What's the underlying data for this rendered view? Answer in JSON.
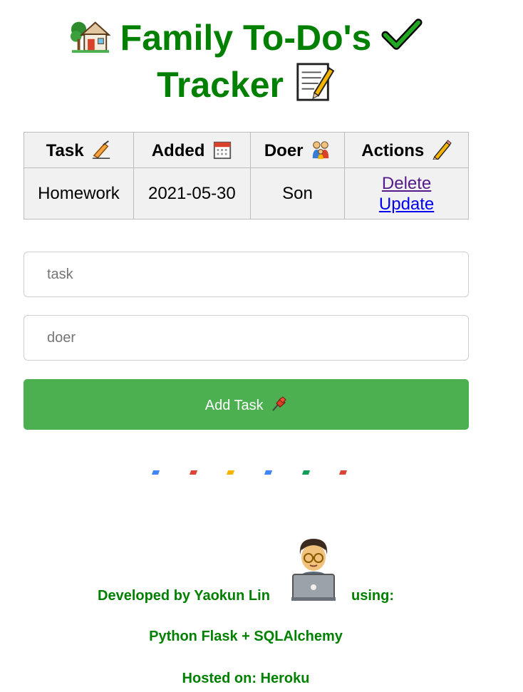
{
  "header": {
    "title_line1": "Family To-Do's",
    "title_line2": "Tracker",
    "icons": [
      "house-with-garden-icon",
      "check-mark-icon",
      "memo-icon"
    ]
  },
  "table": {
    "columns": [
      {
        "label": "Task",
        "icon": "writing-hand-icon"
      },
      {
        "label": "Added",
        "icon": "calendar-icon"
      },
      {
        "label": "Doer",
        "icon": "family-icon"
      },
      {
        "label": "Actions",
        "icon": "pencil-icon"
      }
    ],
    "rows": [
      {
        "task": "Homework",
        "added": "2021-05-30",
        "doer": "Son",
        "delete_label": "Delete",
        "update_label": "Update"
      }
    ]
  },
  "form": {
    "task_placeholder": "task",
    "doer_placeholder": "doer",
    "add_button_label": "Add Task",
    "add_button_icon": "pushpin-icon"
  },
  "loader": {
    "dot_colors": [
      "#4285f4",
      "#db4437",
      "#f4b400",
      "#4285f4",
      "#0f9d58",
      "#db4437"
    ]
  },
  "footer": {
    "developed_by": "Developed by Yaokun Lin",
    "developer_icon": "technologist-icon",
    "using": "using:",
    "stack": "Python Flask + SQLAlchemy",
    "hosted": "Hosted on: Heroku"
  },
  "colors": {
    "title_green": "#008000",
    "button_green": "#4caf50"
  }
}
